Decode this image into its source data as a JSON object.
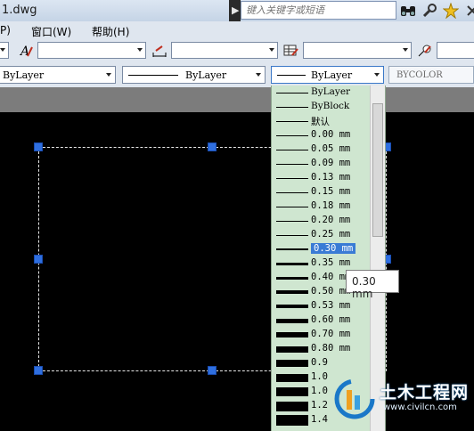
{
  "window": {
    "title": "1.dwg",
    "separator_glyph": "▶"
  },
  "search": {
    "placeholder": "键入关键字或短语"
  },
  "title_icons": [
    "binoculars-icon",
    "wrench-icon",
    "star-icon",
    "close-icon"
  ],
  "menu": {
    "items": [
      "P)",
      "窗口(W)",
      "帮助(H)"
    ]
  },
  "properties": {
    "layer_value": "ByLayer",
    "linetype_value": "ByLayer",
    "lineweight_value": "ByLayer",
    "plotstyle_value": "BYCOLOR"
  },
  "lineweight_list": {
    "selected": "0.30 mm",
    "items": [
      {
        "label": "ByLayer",
        "weight": 1
      },
      {
        "label": "ByBlock",
        "weight": 1
      },
      {
        "label": "默认",
        "weight": 1
      },
      {
        "label": "0.00 mm",
        "weight": 1
      },
      {
        "label": "0.05 mm",
        "weight": 1
      },
      {
        "label": "0.09 mm",
        "weight": 1
      },
      {
        "label": "0.13 mm",
        "weight": 1
      },
      {
        "label": "0.15 mm",
        "weight": 1
      },
      {
        "label": "0.18 mm",
        "weight": 1
      },
      {
        "label": "0.20 mm",
        "weight": 1
      },
      {
        "label": "0.25 mm",
        "weight": 1
      },
      {
        "label": "0.30 mm",
        "weight": 2
      },
      {
        "label": "0.35 mm",
        "weight": 3
      },
      {
        "label": "0.40 mm",
        "weight": 3
      },
      {
        "label": "0.50 mm",
        "weight": 4
      },
      {
        "label": "0.53 mm",
        "weight": 4
      },
      {
        "label": "0.60 mm",
        "weight": 5
      },
      {
        "label": "0.70 mm",
        "weight": 6
      },
      {
        "label": "0.80 mm",
        "weight": 7
      },
      {
        "label": "0.9",
        "weight": 8
      },
      {
        "label": "1.0",
        "weight": 9
      },
      {
        "label": "1.0",
        "weight": 10
      },
      {
        "label": "1.2",
        "weight": 11
      },
      {
        "label": "1.4",
        "weight": 12
      }
    ]
  },
  "tooltip": {
    "text": "0.30 mm"
  },
  "watermark": {
    "name": "土木工程网",
    "url": "www.civilcn.com"
  },
  "colors": {
    "list_background": "#cfe6d0",
    "selection": "#3a7bd5",
    "grip": "#2f6fe0",
    "canvas": "#000000"
  }
}
